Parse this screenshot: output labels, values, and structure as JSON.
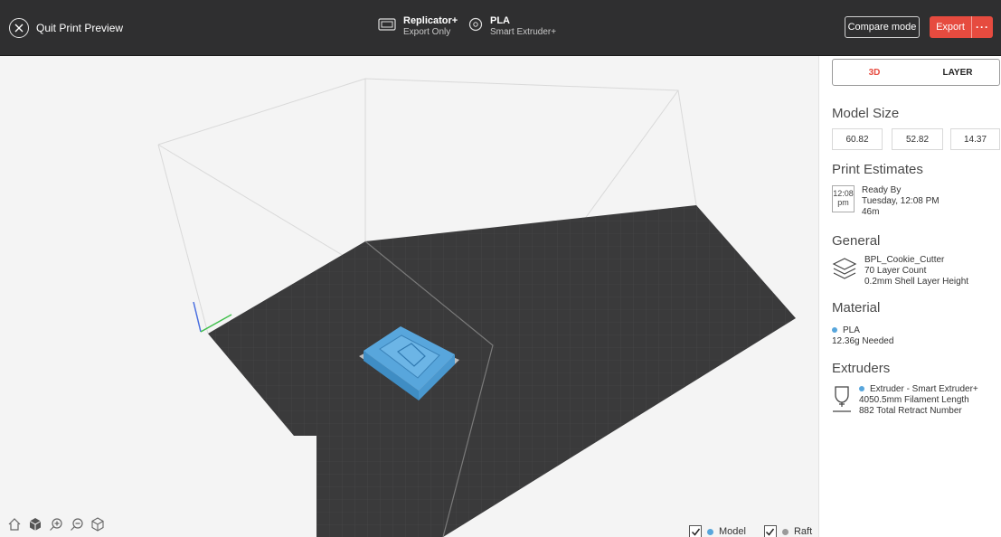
{
  "topbar": {
    "quit_label": "Quit Print Preview",
    "printer": {
      "name": "Replicator+",
      "mode": "Export Only"
    },
    "material": {
      "name": "PLA",
      "extruder": "Smart Extruder+"
    },
    "compare_label": "Compare mode",
    "export_label": "Export",
    "more_label": "···"
  },
  "viewport": {
    "toggles": [
      {
        "label": "Model",
        "checked": true,
        "color": "#58a6dc"
      },
      {
        "label": "Raft",
        "checked": true,
        "color": "#9a9a9a"
      }
    ],
    "tools": [
      "home-icon",
      "cube-view-icon",
      "zoom-in-icon",
      "zoom-out-icon",
      "perspective-icon"
    ]
  },
  "panel": {
    "tabs": [
      {
        "label": "3D",
        "active": true
      },
      {
        "label": "LAYER",
        "active": false
      }
    ],
    "model_size": {
      "title": "Model Size",
      "x": "60.82",
      "y": "52.82",
      "z": "14.37"
    },
    "estimates": {
      "title": "Print Estimates",
      "clock_time": "12:08",
      "clock_ampm": "pm",
      "ready_label": "Ready By",
      "ready_time": "Tuesday, 12:08 PM",
      "duration": "46m"
    },
    "general": {
      "title": "General",
      "file_name": "BPL_Cookie_Cutter",
      "layer_count": "70 Layer Count",
      "shell": "0.2mm Shell Layer Height"
    },
    "material": {
      "title": "Material",
      "name": "PLA",
      "needed": "12.36g Needed",
      "color": "#58a6dc"
    },
    "extruders": {
      "title": "Extruders",
      "name": "Extruder - Smart Extruder+",
      "filament": "4050.5mm Filament Length",
      "retract": "882 Total Retract Number"
    }
  },
  "colors": {
    "accent": "#e64b3f",
    "model": "#58a6dc",
    "topbar": "#2f2f30",
    "plate": "#3a3a3b"
  }
}
